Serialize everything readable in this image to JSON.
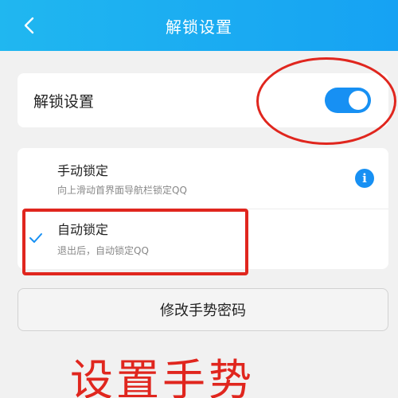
{
  "header": {
    "back_icon": "chevron-left-icon",
    "title": "解锁设置"
  },
  "unlock_setting": {
    "label": "解锁设置",
    "toggle_on": true,
    "toggle_color": "#1790f3"
  },
  "lock_options": [
    {
      "title": "手动锁定",
      "description": "向上滑动首界面导航栏锁定QQ",
      "selected": false,
      "info_icon": "i"
    },
    {
      "title": "自动锁定",
      "description": "退出后，自动锁定QQ",
      "selected": true
    }
  ],
  "gesture_button": {
    "label": "修改手势密码"
  },
  "annotation": {
    "text": "设置手势",
    "color": "#e0261e"
  }
}
